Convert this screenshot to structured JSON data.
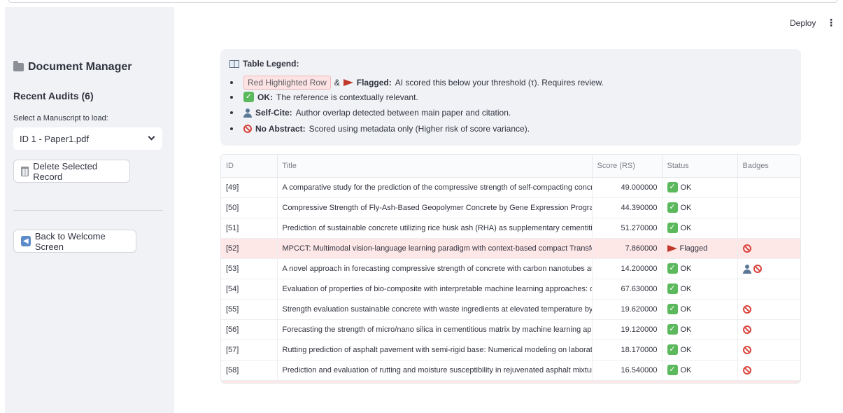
{
  "header": {
    "deploy_label": "Deploy",
    "menu_icon": "kebab-menu-icon"
  },
  "sidebar": {
    "title": "Document Manager",
    "title_icon": "folder-icon",
    "recent_audits": "Recent Audits (6)",
    "select_label": "Select a Manuscript to load:",
    "selected_value": "ID 1 - Paper1.pdf",
    "delete_label": "Delete Selected Record",
    "back_label": "Back to Welcome Screen"
  },
  "legend": {
    "title": "Table Legend:",
    "items": {
      "red_row": "Red Highlighted Row",
      "amp": "&",
      "flagged_bold": "Flagged:",
      "flagged_text": "AI scored this below your threshold (τ). Requires review.",
      "ok_bold": "OK:",
      "ok_text": "The reference is contextually relevant.",
      "selfcite_bold": "Self-Cite:",
      "selfcite_text": "Author overlap detected between main paper and citation.",
      "noabs_bold": "No Abstract:",
      "noabs_text": "Scored using metadata only (Higher risk of score variance)."
    }
  },
  "table": {
    "headers": [
      "ID",
      "Title",
      "Score (RS)",
      "Status",
      "Badges"
    ],
    "rows": [
      {
        "id": "[49]",
        "title": "A comparative study for the prediction of the compressive strength of self-compacting concrete",
        "score": "49.000000",
        "status": "OK",
        "flagged": false,
        "badges": []
      },
      {
        "id": "[50]",
        "title": "Compressive Strength of Fly-Ash-Based Geopolymer Concrete by Gene Expression Programming",
        "score": "44.390000",
        "status": "OK",
        "flagged": false,
        "badges": []
      },
      {
        "id": "[51]",
        "title": "Prediction of sustainable concrete utilizing rice husk ash (RHA) as supplementary cementitious",
        "score": "51.270000",
        "status": "OK",
        "flagged": false,
        "badges": []
      },
      {
        "id": "[52]",
        "title": "MPCCT: Multimodal vision-language learning paradigm with context-based compact Transformer",
        "score": "7.860000",
        "status": "Flagged",
        "flagged": true,
        "badges": [
          "no-abstract"
        ]
      },
      {
        "id": "[53]",
        "title": "A novel approach in forecasting compressive strength of concrete with carbon nanotubes as reinforcement",
        "score": "14.200000",
        "status": "OK",
        "flagged": false,
        "badges": [
          "self-cite",
          "no-abstract"
        ]
      },
      {
        "id": "[54]",
        "title": "Evaluation of properties of bio-composite with interpretable machine learning approaches: optimization",
        "score": "67.630000",
        "status": "OK",
        "flagged": false,
        "badges": []
      },
      {
        "id": "[55]",
        "title": "Strength evaluation sustainable concrete with waste ingredients at elevated temperature by explainable",
        "score": "19.620000",
        "status": "OK",
        "flagged": false,
        "badges": [
          "no-abstract"
        ]
      },
      {
        "id": "[56]",
        "title": "Forecasting the strength of micro/nano silica in cementitious matrix by machine learning approaches",
        "score": "19.120000",
        "status": "OK",
        "flagged": false,
        "badges": [
          "no-abstract"
        ]
      },
      {
        "id": "[57]",
        "title": "Rutting prediction of asphalt pavement with semi-rigid base: Numerical modeling on laboratory",
        "score": "18.170000",
        "status": "OK",
        "flagged": false,
        "badges": [
          "no-abstract"
        ]
      },
      {
        "id": "[58]",
        "title": "Prediction and evaluation of rutting and moisture susceptibility in rejuvenated asphalt mixtures",
        "score": "16.540000",
        "status": "OK",
        "flagged": false,
        "badges": [
          "no-abstract"
        ]
      },
      {
        "id": "",
        "title": "",
        "score": "",
        "status": "",
        "flagged": true,
        "badges": []
      }
    ]
  },
  "colors": {
    "flag_row": "#fde7e7",
    "ok_green": "#5cb85c",
    "flag_red": "#c0392b",
    "noentry_red": "#d9453d",
    "sidebar_bg": "#f0f2f6"
  }
}
